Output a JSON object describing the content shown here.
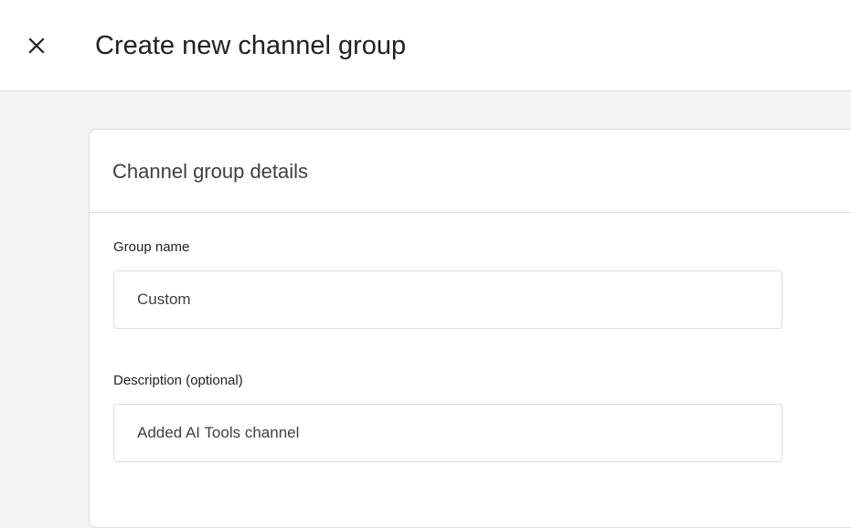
{
  "header": {
    "title": "Create new channel group",
    "close_icon": "close-icon"
  },
  "card": {
    "title": "Channel group details",
    "fields": [
      {
        "label": "Group name",
        "value": "Custom"
      },
      {
        "label": "Description (optional)",
        "value": "Added AI Tools channel"
      }
    ]
  },
  "colors": {
    "page_background": "#f1f3f4",
    "surface": "#ffffff",
    "border": "#dadce0",
    "text_primary": "#202124"
  }
}
